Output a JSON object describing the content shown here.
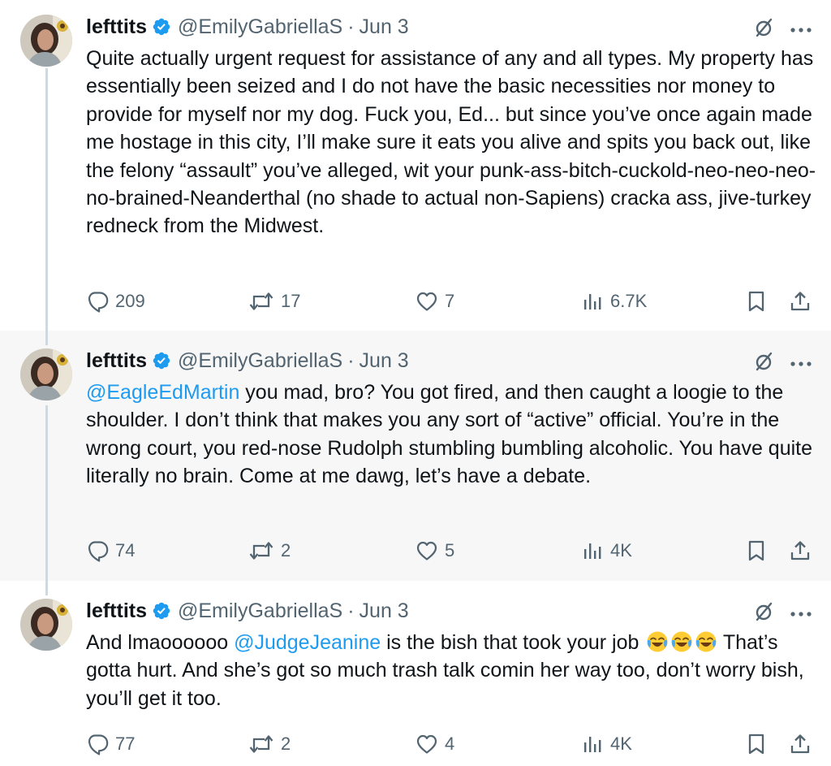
{
  "accent_link": "#1d9bf0",
  "verified_color": "#1d9bf0",
  "muted_text": "#536471",
  "tweets": [
    {
      "name": "lefttits",
      "handle": "@EmilyGabriellaS",
      "date": "Jun 3",
      "verified": true,
      "text": "Quite actually urgent request for assistance of any and all types. My property has essentially been seized and I do not have the basic necessities nor money to provide for myself nor my dog. Fuck you, Ed... but since you’ve once again made me hostage in this city, I’ll make sure it eats you alive and spits you back out, like the felony “assault” you’ve alleged, wit your punk-ass-bitch-cuckold-neo-neo-neo-no-brained-Neanderthal (no shade to actual non-Sapiens) cracka ass, jive-turkey redneck from the Midwest.",
      "replies": "209",
      "reposts": "17",
      "likes": "7",
      "views": "6.7K"
    },
    {
      "name": "lefttits",
      "handle": "@EmilyGabriellaS",
      "date": "Jun 3",
      "verified": true,
      "mention": "@EagleEdMartin",
      "text": " you mad, bro? You got fired, and then caught a loogie to the shoulder. I don’t think that makes you any sort of “active” official. You’re in the wrong court, you red-nose Rudolph stumbling bumbling alcoholic. You have quite literally no brain. Come at me dawg, let’s have a debate.",
      "replies": "74",
      "reposts": "2",
      "likes": "5",
      "views": "4K"
    },
    {
      "name": "lefttits",
      "handle": "@EmilyGabriellaS",
      "date": "Jun 3",
      "verified": true,
      "text_before": "And lmaoooooo ",
      "mention": "@JudgeJeanine",
      "text_after": " is the bish that took your job ",
      "emoji": [
        "face-with-tears-of-joy",
        "face-with-tears-of-joy",
        "face-with-tears-of-joy"
      ],
      "text_end": " That’s gotta hurt. And she’s got so much trash talk comin her way too, don’t worry bish, you’ll get it too.",
      "replies": "77",
      "reposts": "2",
      "likes": "4",
      "views": "4K"
    }
  ],
  "icons": {
    "reply": "speech-bubble-icon",
    "repost": "repost-arrows-icon",
    "like": "heart-icon",
    "views": "bar-chart-icon",
    "bookmark": "bookmark-icon",
    "share": "share-upload-icon",
    "grok": "grok-slash-circle-icon",
    "more": "more-dots-icon",
    "verified": "verified-badge-icon"
  }
}
